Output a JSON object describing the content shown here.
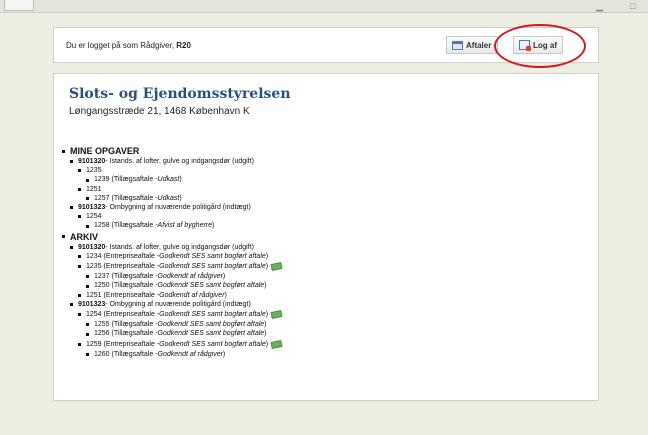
{
  "header": {
    "login_prefix": "Du er logget på som Rådgiver, ",
    "login_user": "R20",
    "aftaler_label": "Aftaler",
    "logaf_label": "Log af"
  },
  "org": {
    "name": "Slots- og Ejendomsstyrelsen",
    "address": "Løngangsstræde 21, 1468 København K"
  },
  "mine_opgaver": {
    "heading": "MINE OPGAVER",
    "projects": [
      {
        "code": "9101320",
        "desc": " - Istands. af lofter, gulve og indgangsdør (udgift)",
        "items": [
          {
            "no": "1235",
            "sub": [
              {
                "text": "1239 (Tillægsaftale - ",
                "status": "Udkast",
                "close": ")"
              }
            ]
          },
          {
            "no": "1251",
            "sub": [
              {
                "text": "1257 (Tillægsaftale - ",
                "status": "Udkast",
                "close": ")"
              }
            ]
          }
        ]
      },
      {
        "code": "9101323",
        "desc": " - Ombygning af nuværende politigård (indtægt)",
        "items": [
          {
            "no": "1254",
            "sub": [
              {
                "text": "1258 (Tillægsaftale - ",
                "status": "Afvist af bygherre",
                "close": ")"
              }
            ]
          }
        ]
      }
    ]
  },
  "arkiv": {
    "heading": "ARKIV",
    "projects": [
      {
        "code": "9101320",
        "desc": " - Istands. af lofter, gulve og indgangsdør (udgift)",
        "rows": [
          {
            "level": 2,
            "text": "1234 (Entrepriseaftale - ",
            "status": "Godkendt SES samt bogført aftale",
            "close": ")",
            "money": false
          },
          {
            "level": 2,
            "text": "1235 (Entrepriseaftale - ",
            "status": "Godkendt SES samt bogført aftale",
            "close": ")",
            "money": true
          },
          {
            "level": 3,
            "text": "1237 (Tillægsaftale - ",
            "status": "Godkendt af rådgiver",
            "close": ")",
            "money": false
          },
          {
            "level": 3,
            "text": "1250 (Tillægsaftale - ",
            "status": "Godkendt SES samt bogført aftale",
            "close": ")",
            "money": false
          },
          {
            "level": 2,
            "text": "1251 (Entrepriseaftale - ",
            "status": "Godkendt af rådgiver",
            "close": ")",
            "money": false
          }
        ]
      },
      {
        "code": "9101323",
        "desc": " - Ombygning af nuværende politigård (indtægt)",
        "rows": [
          {
            "level": 2,
            "text": "1254 (Entrepriseaftale - ",
            "status": "Godkendt SES samt bogført aftale",
            "close": ")",
            "money": true
          },
          {
            "level": 3,
            "text": "1255 (Tillægsaftale - ",
            "status": "Godkendt SES samt bogført aftale",
            "close": ")",
            "money": false
          },
          {
            "level": 3,
            "text": "1256 (Tillægsaftale - ",
            "status": "Godkendt SES samt bogført aftale",
            "close": ")",
            "money": false
          },
          {
            "level": 2,
            "text": "1259 (Entrepriseaftale - ",
            "status": "Godkendt SES samt bogført aftale",
            "close": ")",
            "money": true
          },
          {
            "level": 3,
            "text": "1260 (Tillægsaftale - ",
            "status": "Godkendt af rådgiver",
            "close": ")",
            "money": false
          }
        ]
      }
    ]
  },
  "icons": {
    "aftaler": "calendar-icon",
    "logaf": "logout-icon",
    "money": "money-icon"
  },
  "colors": {
    "org_title": "#2a4f7c",
    "annotation_circle": "#d31a1a"
  }
}
